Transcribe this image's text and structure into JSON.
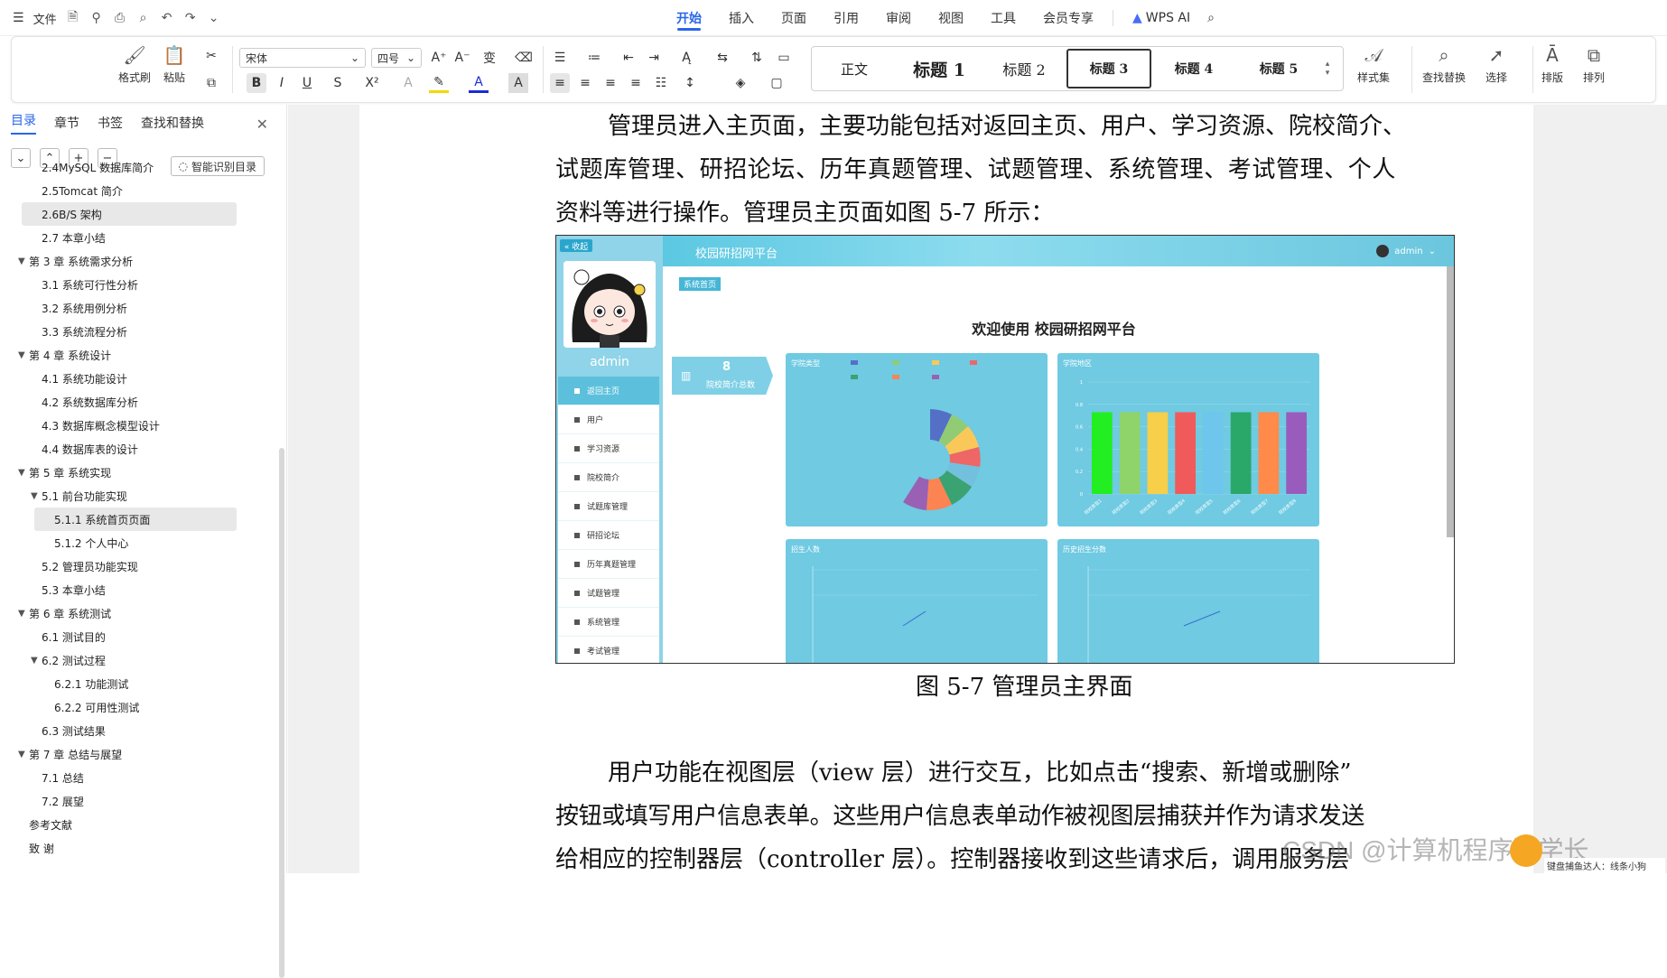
{
  "menubar": {
    "file_label": "文件",
    "tabs": [
      "开始",
      "插入",
      "页面",
      "引用",
      "审阅",
      "视图",
      "工具",
      "会员专享"
    ],
    "wps_ai": "WPS AI"
  },
  "toolbar": {
    "format_painter": "格式刷",
    "paste": "粘贴",
    "font_name": "宋体",
    "font_size": "四号",
    "styles": [
      "正文",
      "标题 1",
      "标题 2",
      "标题 3",
      "标题 4",
      "标题 5"
    ],
    "style_set": "样式集",
    "find_replace": "查找替换",
    "select": "选择",
    "layout": "排版",
    "arrange": "排列"
  },
  "sidebar": {
    "tabs": [
      "目录",
      "章节",
      "书签",
      "查找和替换"
    ],
    "auto_toc": "智能识别目录",
    "toc": [
      {
        "label": "2.4MySQL 数据库简介",
        "level": 2
      },
      {
        "label": "2.5Tomcat 简介",
        "level": 2
      },
      {
        "label": "2.6B/S 架构",
        "level": 2,
        "selected": true
      },
      {
        "label": "2.7 本章小结",
        "level": 2
      },
      {
        "label": "第 3 章  系统需求分析",
        "level": 1
      },
      {
        "label": "3.1 系统可行性分析",
        "level": 2
      },
      {
        "label": "3.2 系统用例分析",
        "level": 2
      },
      {
        "label": "3.3 系统流程分析",
        "level": 2
      },
      {
        "label": "第 4 章  系统设计",
        "level": 1
      },
      {
        "label": "4.1 系统功能设计",
        "level": 2
      },
      {
        "label": "4.2 系统数据库分析",
        "level": 2
      },
      {
        "label": "4.3 数据库概念模型设计",
        "level": 2
      },
      {
        "label": "4.4 数据库表的设计",
        "level": 2
      },
      {
        "label": "第 5 章  系统实现",
        "level": 1
      },
      {
        "label": "5.1 前台功能实现",
        "level": 2,
        "expand": true
      },
      {
        "label": "5.1.1 系统首页页面",
        "level": 3,
        "selected": true
      },
      {
        "label": "5.1.2 个人中心",
        "level": 3
      },
      {
        "label": "5.2 管理员功能实现",
        "level": 2
      },
      {
        "label": "5.3 本章小结",
        "level": 2
      },
      {
        "label": "第 6 章  系统测试",
        "level": 1
      },
      {
        "label": "6.1 测试目的",
        "level": 2
      },
      {
        "label": "6.2 测试过程",
        "level": 2,
        "expand": true
      },
      {
        "label": "6.2.1 功能测试",
        "level": 3
      },
      {
        "label": "6.2.2 可用性测试",
        "level": 3
      },
      {
        "label": "6.3 测试结果",
        "level": 2
      },
      {
        "label": "第 7 章  总结与展望",
        "level": 1
      },
      {
        "label": "7.1 总结",
        "level": 2
      },
      {
        "label": "7.2 展望",
        "level": 2
      },
      {
        "label": "参考文献",
        "level": 1,
        "noarrow": true
      },
      {
        "label": "致  谢",
        "level": 1,
        "noarrow": true
      }
    ]
  },
  "document": {
    "para1": [
      "管理员进入主页面，主要功能包括对返回主页、用户、学习资源、院校简介、",
      "试题库管理、研招论坛、历年真题管理、试题管理、系统管理、考试管理、个人",
      "资料等进行操作。管理员主页面如图 5-7 所示："
    ],
    "caption": "图 5-7 管理员主界面",
    "para2": [
      "用户功能在视图层（view 层）进行交互，比如点击“搜索、新增或删除”",
      "按钮或填写用户信息表单。这些用户信息表单动作被视图层捕获并作为请求发送",
      "给相应的控制器层（controller 层）。控制器接收到这些请求后，调用服务层"
    ]
  },
  "screenshot": {
    "collapse": "« 收起",
    "admin": "admin",
    "title": "校园研招网平台",
    "user": "admin",
    "crumb": "系统首页",
    "welcome": "欢迎使用 校园研招网平台",
    "stat_num": "8",
    "stat_label": "院校简介总数",
    "menu": [
      "返回主页",
      "用户",
      "学习资源",
      "院校简介",
      "试题库管理",
      "研招论坛",
      "历年真题管理",
      "试题管理",
      "系统管理",
      "考试管理"
    ],
    "panels": [
      "学院类型",
      "学院地区",
      "招生人数",
      "历史招生分数"
    ]
  },
  "chart_data": {
    "type": "bar",
    "categories": [
      "院校类型1",
      "院校类型2",
      "院校类型3",
      "院校类型4",
      "院校类型5",
      "院校类型6",
      "院校类型7",
      "院校类型8"
    ],
    "values": [
      0.73,
      0.73,
      0.73,
      0.73,
      0.73,
      0.73,
      0.73,
      0.73
    ],
    "ylim": [
      0,
      1
    ],
    "colors": [
      "#22ee22",
      "#8fd46a",
      "#f7cf48",
      "#f05a5a",
      "#6ec6ec",
      "#2aa86a",
      "#ff8a4a",
      "#9a5cbc"
    ]
  },
  "watermark": "CSDN @计算机程序猿学长",
  "badge_text": "键盘捕鱼达人：线条小狗"
}
